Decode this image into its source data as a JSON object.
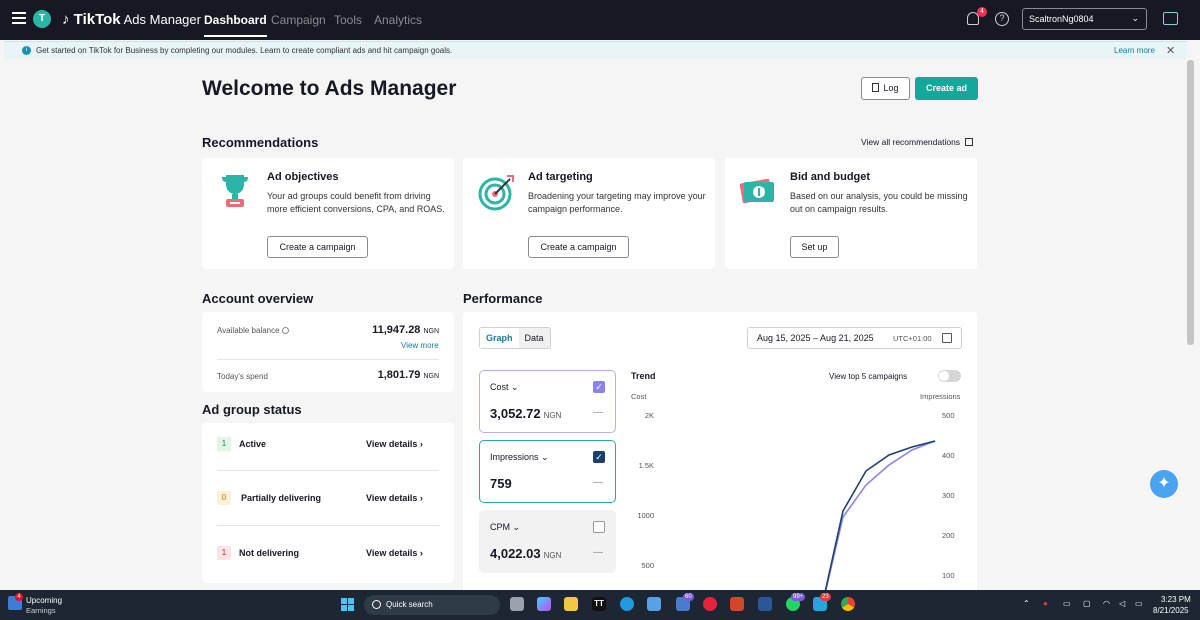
{
  "topbar": {
    "avatar_letter": "T",
    "brand": "TikTok",
    "brand_sub": "Ads Manager",
    "nav": [
      "Dashboard",
      "Campaign",
      "Tools",
      "Analytics"
    ],
    "notification_count": "4",
    "account": "ScaltronNg0804"
  },
  "infobar": {
    "message": "Get started on TikTok for Business by completing our modules. Learn to create compliant ads and hit campaign goals.",
    "learn_more": "Learn more"
  },
  "page": {
    "title": "Welcome to Ads Manager",
    "log_label": "Log",
    "create_ad_label": "Create ad"
  },
  "recommendations": {
    "heading": "Recommendations",
    "view_all": "View all recommendations",
    "cards": [
      {
        "title": "Ad objectives",
        "desc": "Your ad groups could benefit from driving more efficient conversions, CPA, and ROAS.",
        "button": "Create a campaign",
        "icon": "trophy-icon"
      },
      {
        "title": "Ad targeting",
        "desc": "Broadening your targeting may improve your campaign performance.",
        "button": "Create a campaign",
        "icon": "target-icon"
      },
      {
        "title": "Bid and budget",
        "desc": "Based on our analysis, you could be missing out on campaign results.",
        "button": "Set up",
        "icon": "money-icon"
      }
    ]
  },
  "account_overview": {
    "heading": "Account overview",
    "available_balance_label": "Available balance",
    "available_balance": "11,947.28",
    "currency": "NGN",
    "view_more": "View more",
    "todays_spend_label": "Today's spend",
    "todays_spend": "1,801.79"
  },
  "ad_group_status": {
    "heading": "Ad group status",
    "rows": [
      {
        "count": "1",
        "label": "Active",
        "link": "View details",
        "bg": "#e3f5e8",
        "fg": "#1e8a3c"
      },
      {
        "count": "0",
        "label": "Partially delivering",
        "link": "View details",
        "bg": "#fdf0d8",
        "fg": "#b57b00"
      },
      {
        "count": "1",
        "label": "Not delivering",
        "link": "View details",
        "bg": "#fde4e4",
        "fg": "#c92a2a"
      }
    ]
  },
  "performance": {
    "heading": "Performance",
    "tabs": [
      "Graph",
      "Data"
    ],
    "date_range": "Aug 15, 2025 – Aug 21, 2025",
    "timezone": "UTC+01:00",
    "metrics": [
      {
        "label": "Cost",
        "value": "3,052.72",
        "currency": "NGN",
        "dash": "—",
        "checked": true,
        "color": "#8b84e8"
      },
      {
        "label": "Impressions",
        "value": "759",
        "currency": "",
        "dash": "—",
        "checked": true,
        "color": "#1d3f6e"
      },
      {
        "label": "CPM",
        "value": "4,022.03",
        "currency": "NGN",
        "dash": "—",
        "checked": false,
        "color": "#999999"
      }
    ],
    "trend_label": "Trend",
    "toggle_label": "View top 5 campaigns",
    "left_axis_title": "Cost",
    "right_axis_title": "Impressions"
  },
  "chart_data": {
    "type": "line",
    "title": "Trend",
    "ylabel": "Cost",
    "y2label": "Impressions",
    "y_ticks": [
      "2K",
      "1.5K",
      "1000",
      "500"
    ],
    "y2_ticks": [
      "500",
      "400",
      "300",
      "200",
      "100"
    ],
    "ylim": [
      0,
      2000
    ],
    "y2lim": [
      0,
      500
    ],
    "series": [
      {
        "name": "Cost",
        "axis": "left",
        "color": "#8b84e8",
        "values": [
          0,
          0,
          0,
          0,
          0,
          0,
          0,
          980,
          1300,
          1500,
          1650,
          1740
        ]
      },
      {
        "name": "Impressions",
        "axis": "right",
        "color": "#1d3f6e",
        "values": [
          0,
          0,
          0,
          0,
          0,
          0,
          0,
          260,
          360,
          400,
          420,
          435
        ]
      }
    ]
  },
  "taskbar": {
    "widget_title": "Upcoming",
    "widget_sub": "Earnings",
    "widget_badge": "4",
    "search_label": "Quick search",
    "time": "3:23 PM",
    "date": "8/21/2025",
    "badge_a": "60",
    "badge_b": "99+",
    "badge_c": "23"
  },
  "colors": {
    "accent": "#14a89a",
    "topbar": "#161823",
    "link": "#157d9b"
  }
}
